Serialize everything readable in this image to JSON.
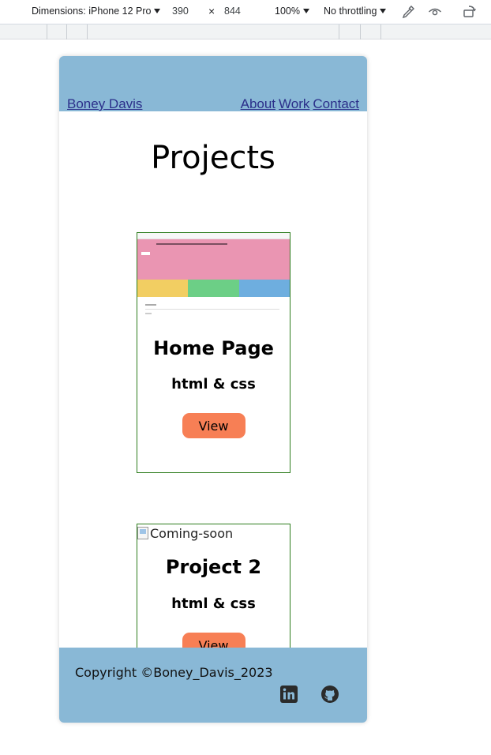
{
  "devtools": {
    "dimensions_label": "Dimensions: iPhone 12 Pro",
    "width": "390",
    "times": "×",
    "height": "844",
    "zoom": "100%",
    "throttling": "No throttling",
    "icons": [
      "eyedropper-icon",
      "eye-icon",
      "rotate-icon"
    ]
  },
  "header": {
    "brand": "Boney Davis",
    "nav": [
      "About",
      "Work",
      "Contact"
    ],
    "bg_color": "#89b8d6"
  },
  "main": {
    "title": "Projects",
    "projects": [
      {
        "thumbnail": "Home Page screenshot",
        "title": "Home Page",
        "tech": "html & css",
        "button": "View"
      },
      {
        "image_alt": "Coming-soon",
        "title": "Project 2",
        "tech": "html & css",
        "button": "View"
      }
    ]
  },
  "footer": {
    "copyright": "Copyright ©Boney_Davis_2023",
    "icons": [
      "linkedin-icon",
      "github-icon"
    ]
  }
}
